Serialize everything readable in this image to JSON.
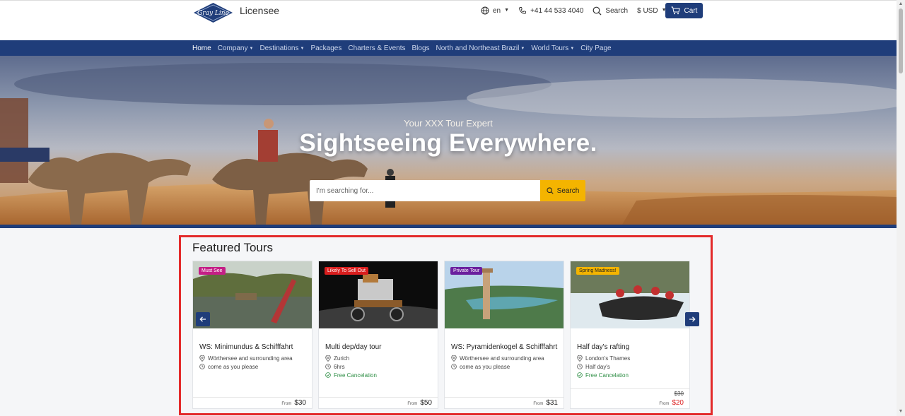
{
  "header": {
    "brand": "Licensee",
    "logo_text": "Gray Line",
    "language": "en",
    "phone": "+41 44 533 4040",
    "search_label": "Search",
    "currency": "$ USD",
    "cart_label": "Cart"
  },
  "nav": {
    "items": [
      {
        "label": "Home",
        "dropdown": false
      },
      {
        "label": "Company",
        "dropdown": true
      },
      {
        "label": "Destinations",
        "dropdown": true
      },
      {
        "label": "Packages",
        "dropdown": false
      },
      {
        "label": "Charters & Events",
        "dropdown": false
      },
      {
        "label": "Blogs",
        "dropdown": false
      },
      {
        "label": "North and Northeast Brazil",
        "dropdown": true
      },
      {
        "label": "World Tours",
        "dropdown": true
      },
      {
        "label": "City Page",
        "dropdown": false
      }
    ]
  },
  "hero": {
    "subtitle": "Your XXX Tour Expert",
    "title": "Sightseeing Everywhere.",
    "search_placeholder": "I'm searching for...",
    "search_button": "Search"
  },
  "featured": {
    "heading": "Featured Tours",
    "tours": [
      {
        "badge": "Must See",
        "badge_color": "#c41f86",
        "title": "WS: Minimundus & Schifffahrt",
        "location": "Wörthersee and surrounding area",
        "duration": "come as you please",
        "cancellation": "",
        "from_label": "From",
        "price": "$30",
        "old_price": ""
      },
      {
        "badge": "Likely To Sell Out",
        "badge_color": "#d91e1e",
        "title": "Multi dep/day tour",
        "location": "Zurich",
        "duration": "6hrs",
        "cancellation": "Free Cancelation",
        "from_label": "From",
        "price": "$50",
        "old_price": ""
      },
      {
        "badge": "Private Tour",
        "badge_color": "#6b1f9e",
        "title": "WS: Pyramidenkogel & Schifffahrt",
        "location": "Wörthersee and surrounding area",
        "duration": "come as you please",
        "cancellation": "",
        "from_label": "From",
        "price": "$31",
        "old_price": ""
      },
      {
        "badge": "Spring Madness!",
        "badge_color": "#f4b400",
        "title": "Half day's rafting",
        "location": "London's Thames",
        "duration": "Half day's",
        "cancellation": "Free Cancelation",
        "from_label": "From",
        "price": "$20",
        "old_price": "$30"
      }
    ]
  },
  "colors": {
    "primary": "#1f3d7a",
    "accent": "#f4b400",
    "highlight_border": "#e32a2a",
    "free_cancel": "#2f8f46",
    "sale_price": "#dd2222"
  }
}
